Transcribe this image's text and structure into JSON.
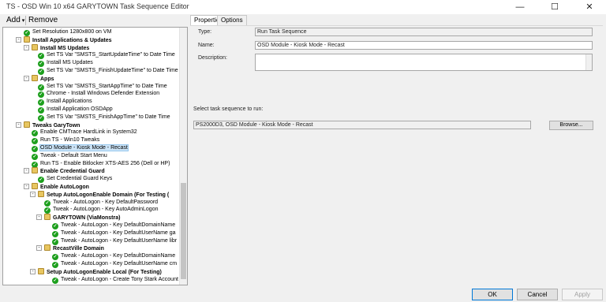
{
  "window": {
    "title": "TS - OSD Win 10 x64 GARYTOWN Task Sequence Editor",
    "controls": {
      "minimize": "—",
      "maximize": "☐",
      "close": "✕"
    }
  },
  "toolbar": {
    "add_label": "Add",
    "remove_label": "Remove",
    "caret": "▾"
  },
  "tree": {
    "rows": [
      {
        "label": "Set Resolution 1280x800 on VM",
        "type": "step"
      },
      {
        "label": "Install Applications & Updates",
        "type": "group",
        "expander": "-"
      },
      {
        "label": "Install MS Updates",
        "type": "group",
        "expander": "-"
      },
      {
        "label": "Set TS Var \"SMSTS_StartUpdateTime\" to Date Time",
        "type": "step"
      },
      {
        "label": "Install MS Updates",
        "type": "step"
      },
      {
        "label": "Set TS Var \"SMSTS_FinishUpdateTime\" to Date Time",
        "type": "step"
      },
      {
        "label": "Apps",
        "type": "group",
        "expander": "-"
      },
      {
        "label": "Set TS Var \"SMSTS_StartAppTime\" to Date Time",
        "type": "step"
      },
      {
        "label": "Chrome - Install Windows Defender Extension",
        "type": "step"
      },
      {
        "label": "Install Applications",
        "type": "step"
      },
      {
        "label": "Install Application OSDApp",
        "type": "step"
      },
      {
        "label": "Set TS Var \"SMSTS_FinishAppTime\" to Date Time",
        "type": "step"
      },
      {
        "label": "Tweaks GaryTown",
        "type": "group",
        "expander": "-"
      },
      {
        "label": "Enable CMTrace HardLink in System32",
        "type": "step"
      },
      {
        "label": "Run TS - Win10 Tweaks",
        "type": "step"
      },
      {
        "label": "OSD Module - Kiosk Mode - Recast",
        "type": "step",
        "selected": true
      },
      {
        "label": "Tweak - Default Start Menu",
        "type": "step"
      },
      {
        "label": "Run TS - Enable Bitlocker XTS-AES 256 (Dell or HP)",
        "type": "step"
      },
      {
        "label": "Enable Credential Guard",
        "type": "group",
        "expander": "-"
      },
      {
        "label": "Set Credential Guard Keys",
        "type": "step"
      },
      {
        "label": "Enable AutoLogon",
        "type": "group",
        "expander": "-"
      },
      {
        "label": "Setup AutoLogonEnable Domain (For Testing (",
        "type": "group",
        "expander": "-"
      },
      {
        "label": "Tweak - AutoLogon - Key DefaultPassword",
        "type": "step"
      },
      {
        "label": "Tweak - AutoLogon - Key AutoAdminLogon",
        "type": "step"
      },
      {
        "label": "GARYTOWN (ViaMonstra)",
        "type": "group",
        "expander": "-"
      },
      {
        "label": "Tweak - AutoLogon - Key DefaultDomainName",
        "type": "step"
      },
      {
        "label": "Tweak - AutoLogon - Key DefaultUserName ga",
        "type": "step"
      },
      {
        "label": "Tweak - AutoLogon - Key DefaultUserName libr",
        "type": "step"
      },
      {
        "label": "RecastVille Domain",
        "type": "group",
        "expander": "-"
      },
      {
        "label": "Tweak - AutoLogon - Key DefaultDomainName",
        "type": "step"
      },
      {
        "label": "Tweak - AutoLogon - Key DefaultUserName cm",
        "type": "step"
      },
      {
        "label": "Setup AutoLogonEnable Local (For Testing)",
        "type": "group",
        "expander": "-"
      },
      {
        "label": "Tweak - AutoLogon - Create Tony Stark Account",
        "type": "step"
      }
    ]
  },
  "tabs": {
    "properties": "Properties",
    "options": "Options"
  },
  "properties": {
    "type_label": "Type:",
    "type_value": "Run Task Sequence",
    "name_label": "Name:",
    "name_value": "OSD Module - Kiosk Mode - Recast",
    "description_label": "Description:",
    "description_value": "",
    "select_label": "Select task sequence to run:",
    "ts_value": "PS2000D3, OSD Module - Kiosk Mode - Recast",
    "browse_label": "Browse..."
  },
  "footer": {
    "ok": "OK",
    "cancel": "Cancel",
    "apply": "Apply"
  }
}
